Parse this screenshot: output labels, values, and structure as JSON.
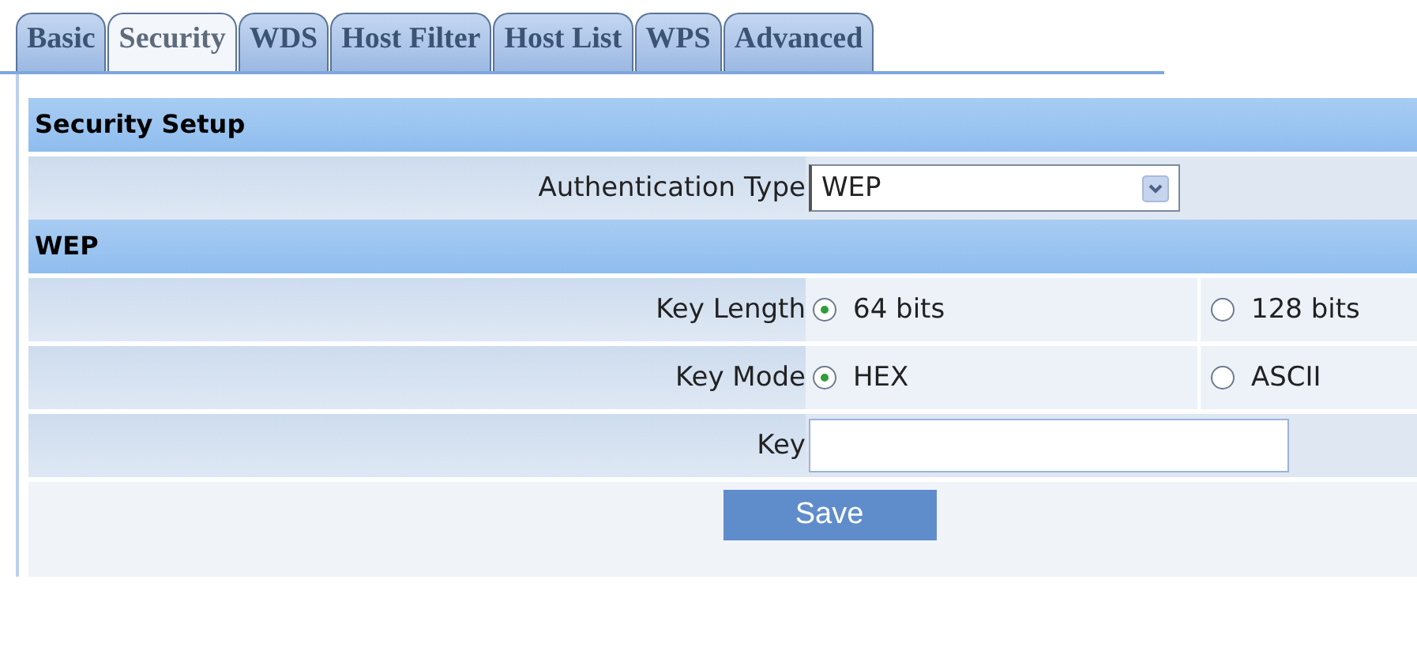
{
  "tabs": [
    {
      "label": "Basic",
      "selected": false
    },
    {
      "label": "Security",
      "selected": true
    },
    {
      "label": "WDS",
      "selected": false
    },
    {
      "label": "Host Filter",
      "selected": false
    },
    {
      "label": "Host List",
      "selected": false
    },
    {
      "label": "WPS",
      "selected": false
    },
    {
      "label": "Advanced",
      "selected": false
    }
  ],
  "security_setup": {
    "title": "Security Setup",
    "authentication_type": {
      "label": "Authentication Type",
      "value": "WEP"
    }
  },
  "wep": {
    "title": "WEP",
    "radio_rows": [
      {
        "label": "Key Length",
        "options": [
          {
            "label": "64 bits",
            "selected": true
          },
          {
            "label": "128 bits",
            "selected": false
          }
        ]
      },
      {
        "label": "Key Mode",
        "options": [
          {
            "label": "HEX",
            "selected": true
          },
          {
            "label": "ASCII",
            "selected": false
          }
        ]
      }
    ],
    "key": {
      "label": "Key"
    },
    "save_button": "Save"
  }
}
